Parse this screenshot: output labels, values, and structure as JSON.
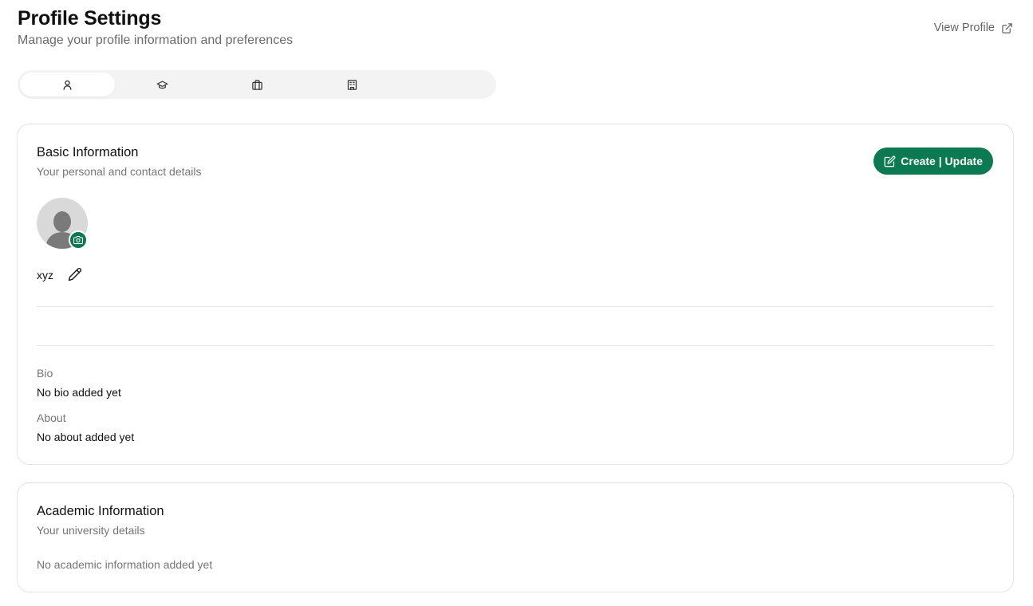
{
  "header": {
    "title": "Profile Settings",
    "subtitle": "Manage your profile information and preferences",
    "view_profile_label": "View Profile"
  },
  "tabs": [
    {
      "icon": "user-icon",
      "active": true
    },
    {
      "icon": "graduation-cap-icon",
      "active": false
    },
    {
      "icon": "briefcase-icon",
      "active": false
    },
    {
      "icon": "building-icon",
      "active": false
    }
  ],
  "basic_info": {
    "title": "Basic Information",
    "subtitle": "Your personal and contact details",
    "update_button_label": "Create | Update",
    "username": "xyz",
    "bio_label": "Bio",
    "bio_value": "No bio added yet",
    "about_label": "About",
    "about_value": "No about added yet"
  },
  "academic_info": {
    "title": "Academic Information",
    "subtitle": "Your university details",
    "empty_message": "No academic information added yet"
  },
  "colors": {
    "accent": "#0b7a52",
    "tab_bar_bg": "#f3f3f3",
    "muted_text": "#757575"
  }
}
